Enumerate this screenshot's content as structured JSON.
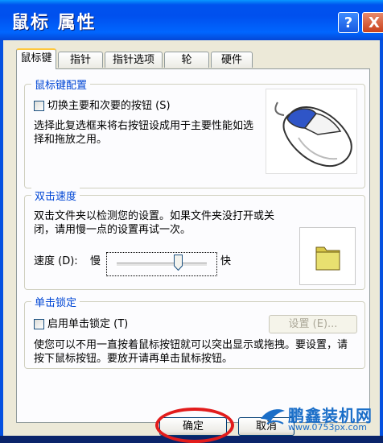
{
  "window": {
    "title": "鼠标 属性",
    "help_label": "?",
    "close_label": "X"
  },
  "tabs": [
    {
      "label": "鼠标键",
      "active": true
    },
    {
      "label": "指针",
      "active": false
    },
    {
      "label": "指针选项",
      "active": false
    },
    {
      "label": "轮",
      "active": false
    },
    {
      "label": "硬件",
      "active": false
    }
  ],
  "button_config": {
    "title": "鼠标键配置",
    "checkbox_label": "切换主要和次要的按钮 (S)",
    "checked": false,
    "description": "选择此复选框来将右按钮设成用于主要性能如选择和拖放之用。"
  },
  "double_click": {
    "title": "双击速度",
    "description": "双击文件夹以检测您的设置。如果文件夹没打开或关闭，请用慢一点的设置再试一次。",
    "speed_label": "速度 (D):",
    "slow_label": "慢",
    "fast_label": "快",
    "speed_value": 0.7
  },
  "click_lock": {
    "title": "单击锁定",
    "checkbox_label": "启用单击锁定 (T)",
    "checked": false,
    "settings_label": "设置 (E)...",
    "description": "使您可以不用一直按着鼠标按钮就可以突出显示或拖拽。要设置，请按下鼠标按钮。要放开请再单击鼠标按钮。"
  },
  "footer": {
    "ok_label": "确定",
    "cancel_label": "取消"
  },
  "watermark": {
    "brand": "鹏鑫装机网",
    "url": "www.0753px.com"
  },
  "colors": {
    "titlebar": "#0053ee",
    "group_title": "#0046d5",
    "highlight_ring": "#e21c1c"
  }
}
